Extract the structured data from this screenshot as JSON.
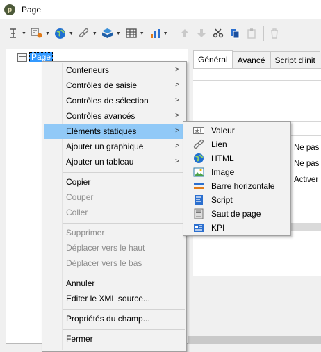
{
  "window": {
    "title": "Page",
    "logo_text": "p"
  },
  "toolbar": {
    "icons": [
      "insert-cursor-icon",
      "form-control-icon",
      "globe-icon",
      "link-icon",
      "box-icon",
      "table-icon",
      "chart-icon",
      "move-up-icon",
      "move-down-icon",
      "cut-icon",
      "copy-icon",
      "paste-icon",
      "delete-icon"
    ]
  },
  "tree": {
    "root_label": "Page"
  },
  "tabs": [
    "Général",
    "Avancé",
    "Script d'init"
  ],
  "form_options": [
    "Ne pas a",
    "Ne pas a",
    "Activer l"
  ],
  "context_menu": {
    "items": [
      {
        "label": "Conteneurs",
        "submenu": true,
        "enabled": true
      },
      {
        "label": "Contrôles de saisie",
        "submenu": true,
        "enabled": true
      },
      {
        "label": "Contrôles de sélection",
        "submenu": true,
        "enabled": true
      },
      {
        "label": "Contrôles avancés",
        "submenu": true,
        "enabled": true
      },
      {
        "label": "Eléments statiques",
        "submenu": true,
        "enabled": true,
        "highlighted": true
      },
      {
        "label": "Ajouter un graphique",
        "submenu": true,
        "enabled": true
      },
      {
        "label": "Ajouter un tableau",
        "submenu": true,
        "enabled": true
      },
      {
        "label": "Copier",
        "enabled": true
      },
      {
        "label": "Couper",
        "enabled": false
      },
      {
        "label": "Coller",
        "enabled": false
      },
      {
        "label": "Supprimer",
        "enabled": false
      },
      {
        "label": "Déplacer vers le haut",
        "enabled": false
      },
      {
        "label": "Déplacer vers le bas",
        "enabled": false
      },
      {
        "label": "Annuler",
        "enabled": true
      },
      {
        "label": "Editer le XML source...",
        "enabled": true
      },
      {
        "label": "Propriétés du champ...",
        "enabled": true
      },
      {
        "label": "Fermer",
        "enabled": true
      }
    ]
  },
  "submenu": {
    "items": [
      {
        "label": "Valeur",
        "icon": "value-field-icon"
      },
      {
        "label": "Lien",
        "icon": "link-icon"
      },
      {
        "label": "HTML",
        "icon": "globe-icon"
      },
      {
        "label": "Image",
        "icon": "image-icon"
      },
      {
        "label": "Barre horizontale",
        "icon": "horizontal-bar-icon"
      },
      {
        "label": "Script",
        "icon": "script-icon"
      },
      {
        "label": "Saut de page",
        "icon": "page-break-icon"
      },
      {
        "label": "KPI",
        "icon": "kpi-icon"
      }
    ]
  },
  "colors": {
    "highlight": "#91c9f7",
    "selection": "#3399ff",
    "menu_bg": "#f2f2f2"
  }
}
